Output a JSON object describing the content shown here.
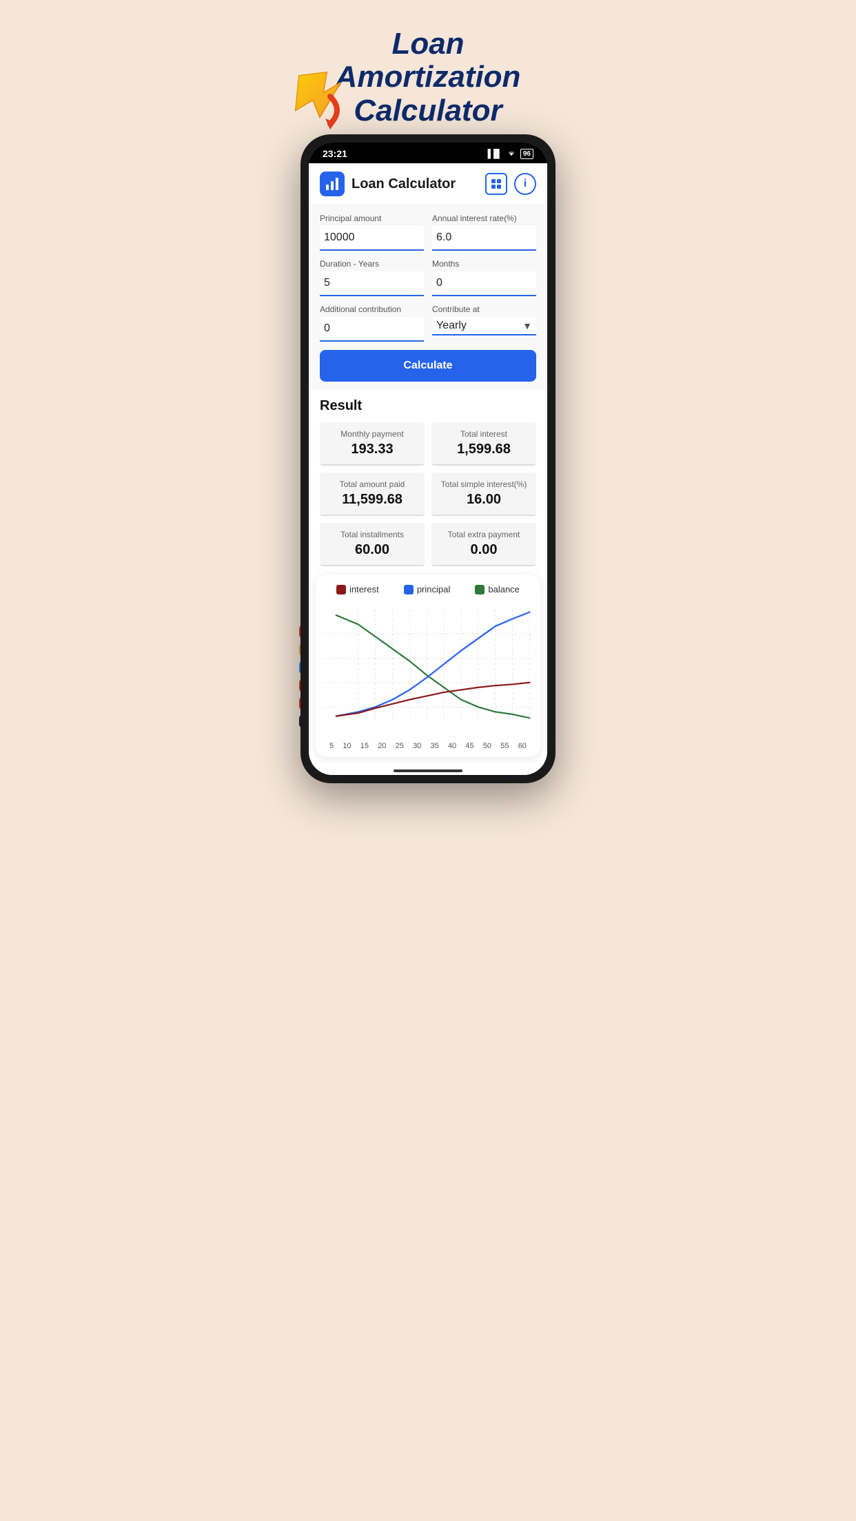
{
  "page": {
    "bg_color": "#f5e6d8",
    "title_line1": "Loan Amortization",
    "title_line2": "Calculator"
  },
  "status_bar": {
    "time": "23:21",
    "battery": "96",
    "signal": "▐▐▌",
    "wifi": "WiFi"
  },
  "header": {
    "title": "Loan Calculator",
    "logo_icon": "📊",
    "grid_icon": "⊞",
    "info_icon": "i"
  },
  "form": {
    "principal_label": "Principal amount",
    "principal_value": "10000",
    "interest_label": "Annual interest rate(%)",
    "interest_value": "6.0",
    "duration_label": "Duration - Years",
    "duration_value": "5",
    "months_label": "Months",
    "months_value": "0",
    "contribution_label": "Additional contribution",
    "contribution_value": "0",
    "contribute_at_label": "Contribute at",
    "contribute_at_value": "Yearly",
    "calculate_label": "Calculate"
  },
  "result": {
    "title": "Result",
    "monthly_payment_label": "Monthly payment",
    "monthly_payment_value": "193.33",
    "total_interest_label": "Total interest",
    "total_interest_value": "1,599.68",
    "total_amount_label": "Total amount paid",
    "total_amount_value": "11,599.68",
    "simple_interest_label": "Total simple interest(%)",
    "simple_interest_value": "16.00",
    "total_installments_label": "Total installments",
    "total_installments_value": "60.00",
    "total_extra_label": "Total extra payment",
    "total_extra_value": "0.00"
  },
  "chart": {
    "legend": {
      "interest_label": "interest",
      "interest_color": "#8b1a1a",
      "principal_label": "principal",
      "principal_color": "#2563eb",
      "balance_label": "balance",
      "balance_color": "#2d7a3a"
    },
    "x_labels": [
      "5",
      "10",
      "15",
      "20",
      "25",
      "30",
      "35",
      "40",
      "45",
      "50",
      "55",
      "60"
    ]
  },
  "home_indicator": {}
}
